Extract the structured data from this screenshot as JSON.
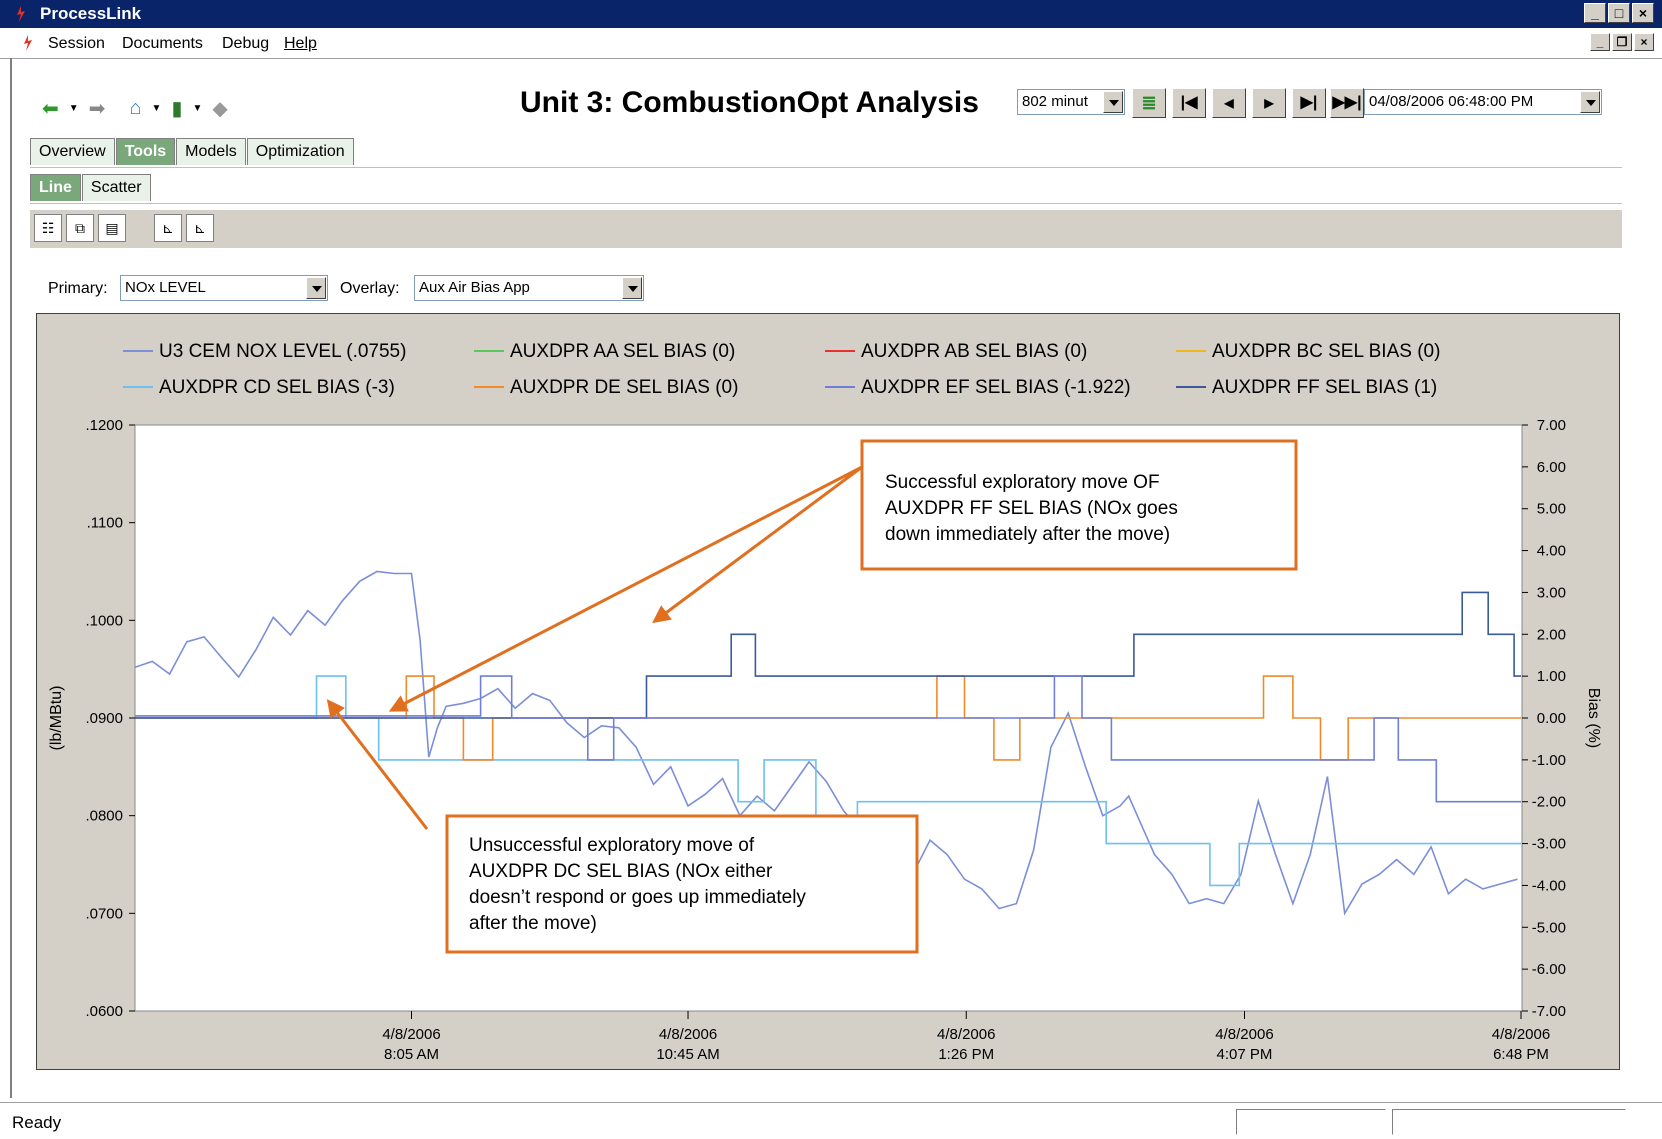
{
  "window": {
    "title": "ProcessLink"
  },
  "menu": {
    "items": [
      "Session",
      "Documents",
      "Debug",
      "Help"
    ]
  },
  "header": {
    "title": "Unit 3: CombustionOpt Analysis",
    "range_value": "802 minut",
    "datetime_value": "04/08/2006 06:48:00 PM"
  },
  "tabs": {
    "main": [
      "Overview",
      "Tools",
      "Models",
      "Optimization"
    ],
    "main_active": "Tools",
    "sub": [
      "Line",
      "Scatter"
    ],
    "sub_active": "Line"
  },
  "selectors": {
    "primary_label": "Primary:",
    "primary_value": "NOx LEVEL",
    "overlay_label": "Overlay:",
    "overlay_value": "Aux Air Bias App"
  },
  "status": {
    "text": "Ready"
  },
  "annotations": {
    "successful": [
      "Successful exploratory move OF",
      "AUXDPR FF SEL BIAS (NOx goes",
      "down immediately after the move)"
    ],
    "unsuccessful": [
      "Unsuccessful exploratory move of",
      "AUXDPR DC SEL BIAS (NOx either",
      "doesn’t respond or goes up immediately",
      "after the move)"
    ]
  },
  "colors": {
    "titlebar": "#0a246a",
    "chart_frame": "#d4d0c8",
    "annotation": "#e07020"
  },
  "chart_data": {
    "type": "line",
    "title": "",
    "ylabel": "(lb/MBtu)",
    "y2label": "Bias (%)",
    "ylim": [
      0.06,
      0.12
    ],
    "y2lim": [
      -7,
      7
    ],
    "xlim": [
      0,
      802
    ],
    "y_ticks": [
      ".1200",
      ".1100",
      ".1000",
      ".0900",
      ".0800",
      ".0700",
      ".0600"
    ],
    "y_tick_values": [
      0.12,
      0.11,
      0.1,
      0.09,
      0.08,
      0.07,
      0.06
    ],
    "y2_ticks": [
      "7.00",
      "6.00",
      "5.00",
      "4.00",
      "3.00",
      "2.00",
      "1.00",
      "0.00",
      "-1.00",
      "-2.00",
      "-3.00",
      "-4.00",
      "-5.00",
      "-6.00",
      "-7.00"
    ],
    "y2_tick_values": [
      7,
      6,
      5,
      4,
      3,
      2,
      1,
      0,
      -1,
      -2,
      -3,
      -4,
      -5,
      -6,
      -7
    ],
    "x_ticks": [
      {
        "t": 160,
        "date": "4/8/2006",
        "time": "8:05 AM"
      },
      {
        "t": 320,
        "date": "4/8/2006",
        "time": "10:45 AM"
      },
      {
        "t": 481,
        "date": "4/8/2006",
        "time": "1:26 PM"
      },
      {
        "t": 642,
        "date": "4/8/2006",
        "time": "4:07 PM"
      },
      {
        "t": 802,
        "date": "4/8/2006",
        "time": "6:48 PM"
      }
    ],
    "legend": [
      {
        "name": "U3 CEM NOX LEVEL (.0755)",
        "color": "#7b8fd9"
      },
      {
        "name": "AUXDPR AA SEL BIAS (0)",
        "color": "#5cc85c"
      },
      {
        "name": "AUXDPR AB SEL BIAS (0)",
        "color": "#e83030"
      },
      {
        "name": "AUXDPR BC SEL BIAS (0)",
        "color": "#f0b820"
      },
      {
        "name": "AUXDPR CD SEL BIAS (-3)",
        "color": "#6ec0ee"
      },
      {
        "name": "AUXDPR DE SEL BIAS (0)",
        "color": "#f08a2a"
      },
      {
        "name": "AUXDPR EF SEL BIAS (-1.922)",
        "color": "#6f7fd8"
      },
      {
        "name": "AUXDPR FF SEL BIAS (1)",
        "color": "#3a5a9a"
      }
    ],
    "series": [
      {
        "name": "U3 CEM NOX LEVEL (.0755)",
        "axis": "left",
        "color": "#7b8fd9",
        "x": [
          0,
          10,
          20,
          30,
          40,
          50,
          60,
          70,
          80,
          90,
          100,
          110,
          120,
          130,
          140,
          150,
          160,
          165,
          170,
          175,
          180,
          190,
          200,
          210,
          220,
          230,
          240,
          250,
          260,
          270,
          280,
          290,
          300,
          310,
          320,
          330,
          340,
          350,
          360,
          370,
          380,
          390,
          400,
          410,
          420,
          430,
          440,
          450,
          460,
          470,
          480,
          490,
          500,
          510,
          520,
          530,
          540,
          550,
          560,
          570,
          575,
          580,
          590,
          600,
          610,
          620,
          630,
          640,
          650,
          660,
          670,
          680,
          690,
          700,
          710,
          720,
          730,
          740,
          750,
          760,
          770,
          780,
          790,
          800
        ],
        "y": [
          0.0952,
          0.0958,
          0.0945,
          0.0978,
          0.0983,
          0.0962,
          0.0942,
          0.097,
          0.1003,
          0.0985,
          0.101,
          0.0995,
          0.102,
          0.104,
          0.105,
          0.1048,
          0.1048,
          0.098,
          0.086,
          0.089,
          0.0912,
          0.0915,
          0.092,
          0.093,
          0.091,
          0.0925,
          0.0918,
          0.0895,
          0.088,
          0.0892,
          0.089,
          0.087,
          0.0832,
          0.085,
          0.081,
          0.0822,
          0.0838,
          0.08,
          0.082,
          0.0805,
          0.083,
          0.0855,
          0.0835,
          0.0805,
          0.0785,
          0.0755,
          0.071,
          0.074,
          0.0775,
          0.076,
          0.0735,
          0.0725,
          0.0705,
          0.071,
          0.0765,
          0.087,
          0.0905,
          0.085,
          0.08,
          0.081,
          0.082,
          0.08,
          0.076,
          0.074,
          0.071,
          0.0715,
          0.071,
          0.074,
          0.0815,
          0.076,
          0.071,
          0.076,
          0.084,
          0.07,
          0.073,
          0.074,
          0.0755,
          0.074,
          0.0768,
          0.072,
          0.0735,
          0.0725,
          0.073,
          0.0735
        ]
      },
      {
        "name": "AUXDPR CD SEL BIAS (-3)",
        "axis": "right",
        "color": "#6ec0ee",
        "x": [
          0,
          105,
          105,
          122,
          122,
          141,
          141,
          349,
          349,
          364,
          364,
          394,
          394,
          418,
          418,
          562,
          562,
          622,
          622,
          639,
          639,
          802
        ],
        "y": [
          0,
          0,
          1,
          1,
          0,
          0,
          -1,
          -1,
          -2,
          -2,
          -1,
          -1,
          -3,
          -3,
          -2,
          -2,
          -3,
          -3,
          -4,
          -4,
          -3,
          -3
        ]
      },
      {
        "name": "AUXDPR DE SEL BIAS (0)",
        "axis": "right",
        "color": "#f08a2a",
        "x": [
          0,
          157,
          157,
          173,
          173,
          190,
          190,
          207,
          207,
          464,
          464,
          480,
          480,
          497,
          497,
          512,
          512,
          653,
          653,
          670,
          670,
          686,
          686,
          702,
          702,
          802
        ],
        "y": [
          0,
          0,
          1,
          1,
          0,
          0,
          -1,
          -1,
          0,
          0,
          1,
          1,
          0,
          0,
          -1,
          -1,
          0,
          0,
          1,
          1,
          0,
          0,
          -1,
          -1,
          0,
          0
        ]
      },
      {
        "name": "AUXDPR FF SEL BIAS (1)",
        "axis": "right",
        "color": "#3a5a9a",
        "x": [
          0,
          296,
          296,
          345,
          345,
          359,
          359,
          578,
          578,
          768,
          768,
          783,
          783,
          798,
          798,
          802
        ],
        "y": [
          0,
          0,
          1,
          1,
          2,
          2,
          1,
          1,
          2,
          2,
          3,
          3,
          2,
          2,
          1,
          1
        ]
      },
      {
        "name": "AUXDPR EF SEL BIAS (-1.922)",
        "axis": "right",
        "color": "#6f7fd8",
        "x": [
          0,
          200,
          200,
          218,
          218,
          262,
          262,
          277,
          277,
          532,
          532,
          548,
          548,
          565,
          565,
          717,
          717,
          731,
          731,
          753,
          753,
          802
        ],
        "y": [
          0.05,
          0.05,
          1,
          1,
          0,
          0,
          -1,
          -1,
          0,
          0,
          1,
          1,
          0,
          0,
          -1,
          -1,
          0,
          0,
          -1,
          -1,
          -2,
          -2
        ]
      }
    ]
  }
}
